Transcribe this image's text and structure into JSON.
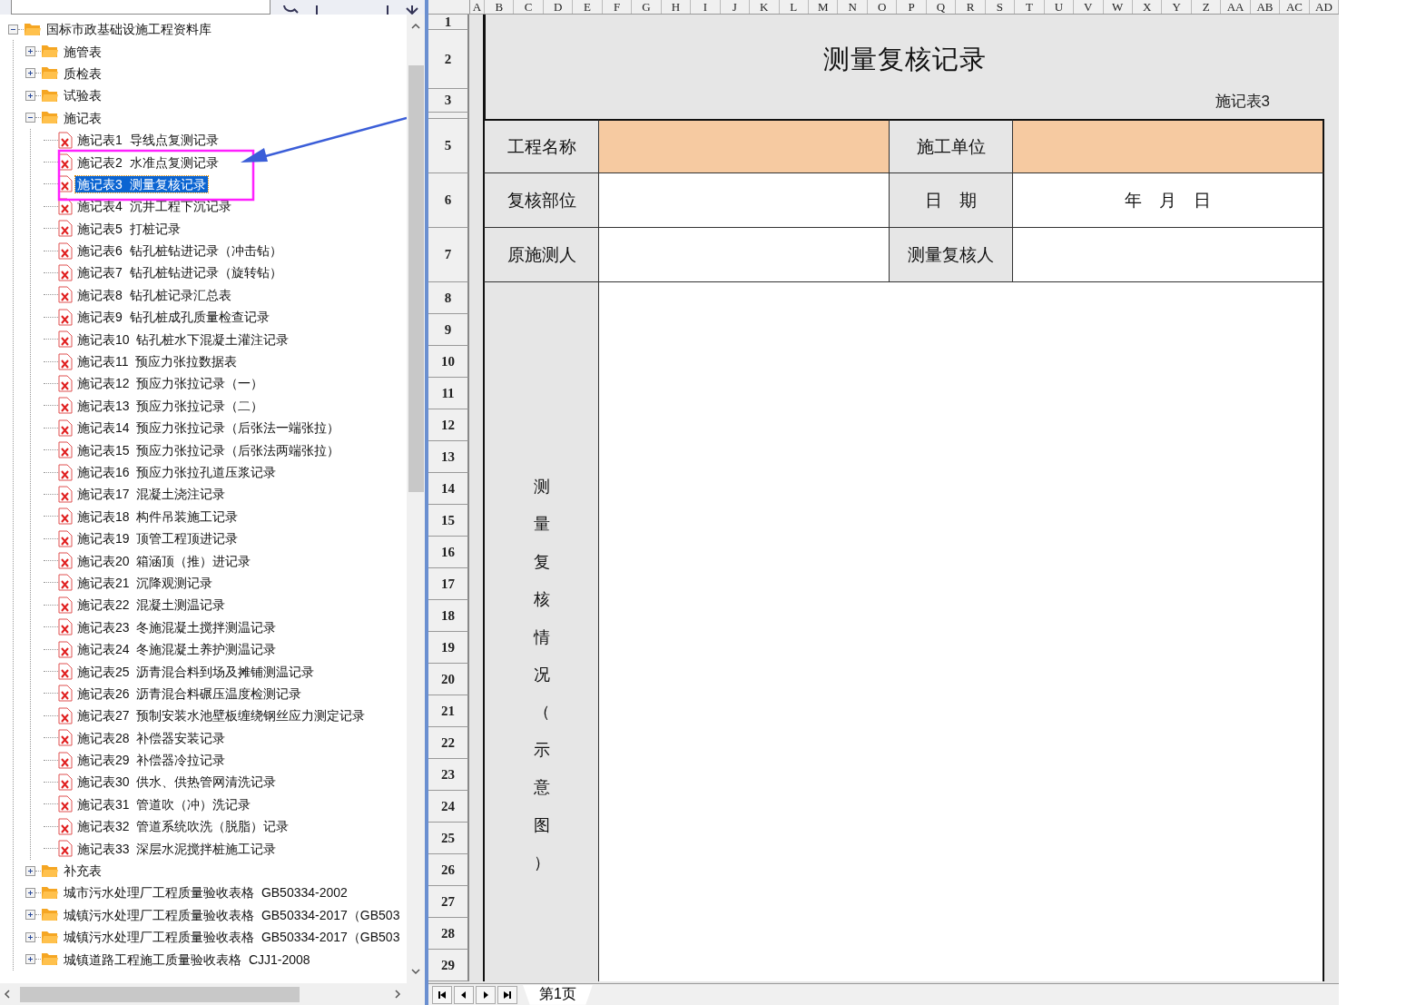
{
  "tree": {
    "label": "国标市政基础设施工程资料库",
    "kind": "folder",
    "expanded": true,
    "selected": false,
    "children": [
      {
        "label": "施管表",
        "kind": "folder",
        "expanded": false,
        "selected": false
      },
      {
        "label": "质检表",
        "kind": "folder",
        "expanded": false,
        "selected": false
      },
      {
        "label": "试验表",
        "kind": "folder",
        "expanded": false,
        "selected": false
      },
      {
        "label": "施记表",
        "kind": "folder",
        "expanded": true,
        "selected": false,
        "children": [
          {
            "label": "施记表1 导线点复测记录",
            "kind": "file",
            "selected": false
          },
          {
            "label": "施记表2 水准点复测记录",
            "kind": "file",
            "selected": false
          },
          {
            "label": "施记表3 测量复核记录",
            "kind": "file",
            "selected": true
          },
          {
            "label": "施记表4 沉井工程下沉记录",
            "kind": "file",
            "selected": false
          },
          {
            "label": "施记表5 打桩记录",
            "kind": "file",
            "selected": false
          },
          {
            "label": "施记表6 钻孔桩钻进记录（冲击钻）",
            "kind": "file",
            "selected": false
          },
          {
            "label": "施记表7 钻孔桩钻进记录（旋转钻）",
            "kind": "file",
            "selected": false
          },
          {
            "label": "施记表8 钻孔桩记录汇总表",
            "kind": "file",
            "selected": false
          },
          {
            "label": "施记表9 钻孔桩成孔质量检查记录",
            "kind": "file",
            "selected": false
          },
          {
            "label": "施记表10 钻孔桩水下混凝土灌注记录",
            "kind": "file",
            "selected": false
          },
          {
            "label": "施记表11 预应力张拉数据表",
            "kind": "file",
            "selected": false
          },
          {
            "label": "施记表12 预应力张拉记录（一）",
            "kind": "file",
            "selected": false
          },
          {
            "label": "施记表13 预应力张拉记录（二）",
            "kind": "file",
            "selected": false
          },
          {
            "label": "施记表14 预应力张拉记录（后张法一端张拉）",
            "kind": "file",
            "selected": false
          },
          {
            "label": "施记表15 预应力张拉记录（后张法两端张拉）",
            "kind": "file",
            "selected": false
          },
          {
            "label": "施记表16 预应力张拉孔道压浆记录",
            "kind": "file",
            "selected": false
          },
          {
            "label": "施记表17 混凝土浇注记录",
            "kind": "file",
            "selected": false
          },
          {
            "label": "施记表18 构件吊装施工记录",
            "kind": "file",
            "selected": false
          },
          {
            "label": "施记表19 顶管工程顶进记录",
            "kind": "file",
            "selected": false
          },
          {
            "label": "施记表20 箱涵顶（推）进记录",
            "kind": "file",
            "selected": false
          },
          {
            "label": "施记表21 沉降观测记录",
            "kind": "file",
            "selected": false
          },
          {
            "label": "施记表22 混凝土测温记录",
            "kind": "file",
            "selected": false
          },
          {
            "label": "施记表23 冬施混凝土搅拌测温记录",
            "kind": "file",
            "selected": false
          },
          {
            "label": "施记表24 冬施混凝土养护测温记录",
            "kind": "file",
            "selected": false
          },
          {
            "label": "施记表25 沥青混合料到场及摊铺测温记录",
            "kind": "file",
            "selected": false
          },
          {
            "label": "施记表26 沥青混合料碾压温度检测记录",
            "kind": "file",
            "selected": false
          },
          {
            "label": "施记表27 预制安装水池壁板缠绕钢丝应力测定记录",
            "kind": "file",
            "selected": false
          },
          {
            "label": "施记表28 补偿器安装记录",
            "kind": "file",
            "selected": false
          },
          {
            "label": "施记表29 补偿器冷拉记录",
            "kind": "file",
            "selected": false
          },
          {
            "label": "施记表30 供水、供热管网清洗记录",
            "kind": "file",
            "selected": false
          },
          {
            "label": "施记表31 管道吹（冲）洗记录",
            "kind": "file",
            "selected": false
          },
          {
            "label": "施记表32 管道系统吹洗（脱脂）记录",
            "kind": "file",
            "selected": false
          },
          {
            "label": "施记表33 深层水泥搅拌桩施工记录",
            "kind": "file",
            "selected": false
          }
        ]
      },
      {
        "label": "补充表",
        "kind": "folder",
        "expanded": false,
        "selected": false
      },
      {
        "label": "城市污水处理厂工程质量验收表格 GB50334-2002",
        "kind": "folder",
        "expanded": false,
        "selected": false
      },
      {
        "label": "城镇污水处理厂工程质量验收表格 GB50334-2017（GB503",
        "kind": "folder",
        "expanded": false,
        "selected": false
      },
      {
        "label": "城镇污水处理厂工程质量验收表格 GB50334-2017（GB503",
        "kind": "folder",
        "expanded": false,
        "selected": false
      },
      {
        "label": "城镇道路工程施工质量验收表格 CJJ1-2008",
        "kind": "folder",
        "expanded": false,
        "selected": false
      }
    ]
  },
  "sheet": {
    "columns": [
      "A",
      "B",
      "C",
      "D",
      "E",
      "F",
      "G",
      "H",
      "I",
      "J",
      "K",
      "L",
      "M",
      "N",
      "O",
      "P",
      "Q",
      "R",
      "S",
      "T",
      "U",
      "V",
      "W",
      "X",
      "Y",
      "Z",
      "AA",
      "AB",
      "AC",
      "AD"
    ],
    "rows": [
      "1",
      "2",
      "3",
      "5",
      "6",
      "7",
      "8",
      "9",
      "10",
      "11",
      "12",
      "13",
      "14",
      "15",
      "16",
      "17",
      "18",
      "19",
      "20",
      "21",
      "22",
      "23",
      "24",
      "25",
      "26",
      "27",
      "28",
      "29"
    ],
    "title": "测量复核记录",
    "form_code": "施记表3",
    "fields": [
      {
        "label": "工程名称",
        "highlighted": true
      },
      {
        "label": "施工单位",
        "highlighted": true
      },
      {
        "label": "复核部位",
        "highlighted": false
      },
      {
        "label": "日　期",
        "value": "年　月　日",
        "highlighted": false
      },
      {
        "label": "原施测人",
        "highlighted": false
      },
      {
        "label": "测量复核人",
        "highlighted": false
      }
    ],
    "section_label": "测量复核情况（示意图）",
    "tabs": [
      {
        "label": "第1页",
        "selected": true
      }
    ]
  }
}
